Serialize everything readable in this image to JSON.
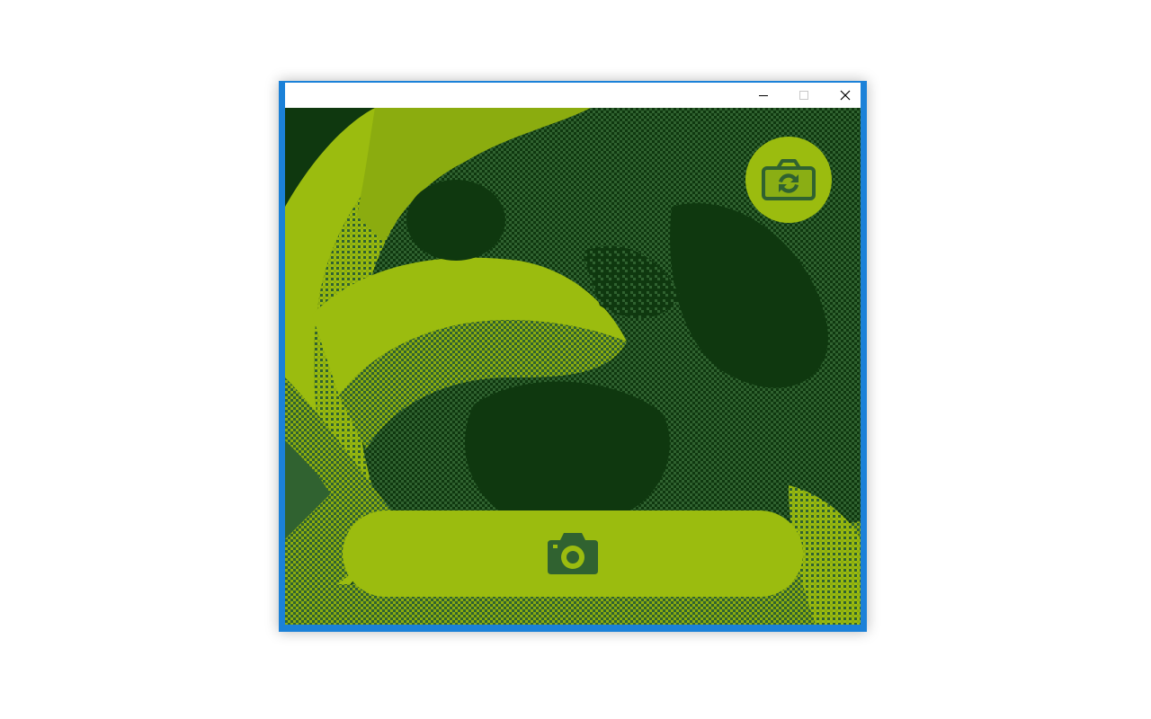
{
  "window": {
    "title": "",
    "controls": {
      "minimize_icon": "minimize-icon",
      "maximize_icon": "maximize-icon",
      "close_icon": "close-icon"
    },
    "frame_color": "#1b81d8"
  },
  "camera": {
    "palette": {
      "darkest": "#0f380f",
      "dark": "#306230",
      "light": "#8bac0f",
      "lightest": "#9bbc0f"
    },
    "switch_camera_button": {
      "icon": "camera-switch-icon"
    },
    "capture_button": {
      "icon": "camera-icon"
    }
  }
}
